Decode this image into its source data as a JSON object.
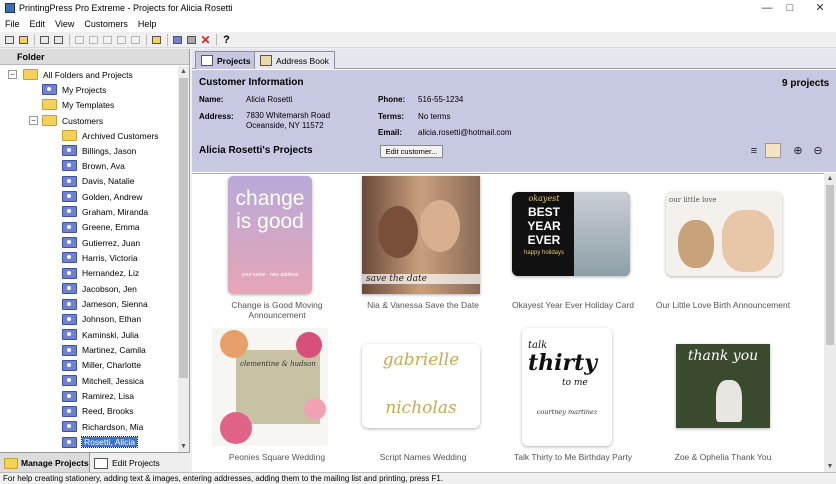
{
  "window": {
    "title": "PrintingPress Pro Extreme - Projects for Alicia Rosetti",
    "minimize_glyph": "—",
    "maximize_glyph": "□",
    "close_glyph": "✕"
  },
  "menu": [
    "File",
    "Edit",
    "View",
    "Customers",
    "Help"
  ],
  "left_panel": {
    "header": "Folder",
    "tree": {
      "expander_minus": "−",
      "root": "All Folders and Projects",
      "my_projects": "My Projects",
      "my_templates": "My Templates",
      "customers": "Customers",
      "archived": "Archived Customers",
      "customer_list": [
        "Billings, Jason",
        "Brown, Ava",
        "Davis, Natalie",
        "Golden, Andrew",
        "Graham, Miranda",
        "Greene, Emma",
        "Gutierrez, Juan",
        "Harris, Victoria",
        "Hernandez, Liz",
        "Jacobson, Jen",
        "Jameson, Sienna",
        "Johnson, Ethan",
        "Kaminski, Julia",
        "Martinez, Camila",
        "Miller, Charlotte",
        "Mitchell, Jessica",
        "Ramirez, Lisa",
        "Reed, Brooks",
        "Richardson, Mia",
        "Rosetti, Alicia"
      ],
      "selected": "Rosetti, Alicia"
    },
    "bottom_tabs": {
      "manage": "Manage Projects",
      "edit": "Edit Projects"
    },
    "scroll_up_glyph": "▲",
    "scroll_down_glyph": "▼"
  },
  "tabs": {
    "projects": "Projects",
    "address_book": "Address Book"
  },
  "customer_info": {
    "title": "Customer Information",
    "project_count": "9 projects",
    "name_label": "Name:",
    "name": "Alicia Rosetti",
    "address_label": "Address:",
    "address_line1": "7830 Whitemarsh Road",
    "address_line2": "Oceanside, NY 11572",
    "phone_label": "Phone:",
    "phone": "516-55-1234",
    "terms_label": "Terms:",
    "terms": "No terms",
    "email_label": "Email:",
    "email": "alicia.rosetti@hotmail.com",
    "edit_button": "Edit customer...",
    "projects_title": "Alicia Rosetti's Projects",
    "view_icons": {
      "list": "≡",
      "zoom_in": "⊕",
      "zoom_out": "⊖"
    }
  },
  "projects": [
    {
      "caption": "Change is Good Moving Announcement",
      "art": [
        "change",
        "is good",
        "your name · new address"
      ]
    },
    {
      "caption": "Nia & Vanessa Save the Date",
      "art": [
        "save the date"
      ]
    },
    {
      "caption": "Okayest Year Ever Holiday Card",
      "art": [
        "okayest",
        "BEST",
        "YEAR",
        "EVER",
        "happy holidays"
      ]
    },
    {
      "caption": "Our Little Love Birth Announcement",
      "art": [
        "our little love"
      ]
    },
    {
      "caption": "Peonies Square Wedding",
      "art": [
        "clementine & hudson"
      ]
    },
    {
      "caption": "Script Names Wedding",
      "art": [
        "gabrielle",
        "nicholas"
      ]
    },
    {
      "caption": "Talk Thirty to Me Birthday Party",
      "art": [
        "talk",
        "thirty",
        "to me",
        "courtney martinez"
      ]
    },
    {
      "caption": "Zoe & Ophelia Thank You",
      "art": [
        "thank you"
      ]
    }
  ],
  "status_text": "For help creating stationery, adding text & images, entering addresses, adding them to the mailing list and printing, press F1.",
  "colors": {
    "info_bg": "#c7c9e3",
    "selection": "#3b74d0",
    "folder_yellow": "#f3d25a",
    "folder_blue": "#6f82d1"
  }
}
